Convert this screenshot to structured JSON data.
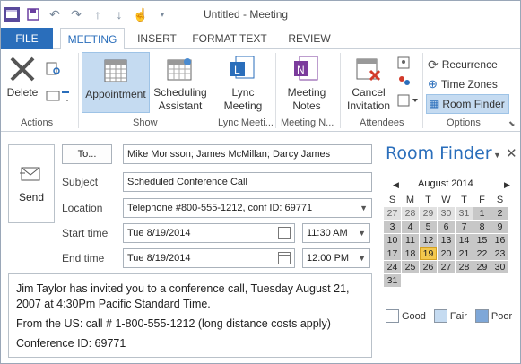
{
  "window": {
    "title": "Untitled - Meeting"
  },
  "tabs": [
    {
      "label": "FILE"
    },
    {
      "label": "MEETING"
    },
    {
      "label": "INSERT"
    },
    {
      "label": "FORMAT TEXT"
    },
    {
      "label": "REVIEW"
    }
  ],
  "ribbon": {
    "actions": {
      "group": "Actions",
      "delete": "Delete"
    },
    "show": {
      "group": "Show",
      "appointment": "Appointment",
      "scheduling1": "Scheduling",
      "scheduling2": "Assistant"
    },
    "lync": {
      "group": "Lync Meeti...",
      "label1": "Lync",
      "label2": "Meeting"
    },
    "notes": {
      "group": "Meeting N...",
      "label1": "Meeting",
      "label2": "Notes"
    },
    "attendees": {
      "group": "Attendees",
      "cancel1": "Cancel",
      "cancel2": "Invitation"
    },
    "options": {
      "group": "Options",
      "recurrence": "Recurrence",
      "timezones": "Time Zones",
      "roomfinder": "Room Finder"
    }
  },
  "form": {
    "send": "Send",
    "to_button": "To...",
    "to_value": "Mike Morisson; James McMillan; Darcy James",
    "subject_label": "Subject",
    "subject_value": "Scheduled Conference Call",
    "location_label": "Location",
    "location_value": "Telephone #800-555-1212, conf ID: 69771",
    "start_label": "Start time",
    "start_date": "Tue 8/19/2014",
    "start_time": "11:30 AM",
    "end_label": "End time",
    "end_date": "Tue 8/19/2014",
    "end_time": "12:00 PM",
    "body": [
      "Jim Taylor has invited you to a conference call, Tuesday August 21, 2007 at 4:30Pm Pacific Standard Time.",
      "From the US: call   # 1-800-555-1212 (long distance costs apply)",
      "Conference ID: 69771"
    ]
  },
  "room_finder": {
    "title": "Room Finder",
    "month": "August 2014",
    "weekdays": [
      "S",
      "M",
      "T",
      "W",
      "T",
      "F",
      "S"
    ],
    "weeks": [
      [
        "27",
        "28",
        "29",
        "30",
        "31",
        "1",
        "2"
      ],
      [
        "3",
        "4",
        "5",
        "6",
        "7",
        "8",
        "9"
      ],
      [
        "10",
        "11",
        "12",
        "13",
        "14",
        "15",
        "16"
      ],
      [
        "17",
        "18",
        "19",
        "20",
        "21",
        "22",
        "23"
      ],
      [
        "24",
        "25",
        "26",
        "27",
        "28",
        "29",
        "30"
      ],
      [
        "31"
      ]
    ],
    "today": "19",
    "legend": [
      {
        "label": "Good",
        "color": "#ffffff"
      },
      {
        "label": "Fair",
        "color": "#c5dbf1"
      },
      {
        "label": "Poor",
        "color": "#7ea7d8"
      }
    ]
  },
  "colors": {
    "accent": "#2a6ebb",
    "selected": "#c5dbf1",
    "today": "#f3c84e"
  }
}
